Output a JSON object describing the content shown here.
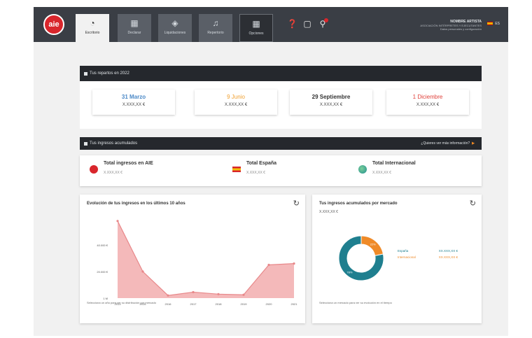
{
  "header": {
    "logo": "aie",
    "tabs": [
      {
        "label": "Escritorio",
        "icon": "dashboard-icon"
      },
      {
        "label": "Declarar",
        "icon": "calendar-icon"
      },
      {
        "label": "Liquidaciones",
        "icon": "coins-icon"
      },
      {
        "label": "Repertorio",
        "icon": "music-note-icon"
      },
      {
        "label": "Opciones",
        "icon": "grid-icon"
      }
    ],
    "user_name": "NOMBRE ARTISTA",
    "user_sub": "ASOCIACIÓN INTÉRPRETES Y EJECUTANTES",
    "user_link": "Datos personales y configuración",
    "lang": "ES"
  },
  "payments": {
    "title": "Tus repartos en 2022",
    "cards": [
      {
        "date": "31 Marzo",
        "value": "X.XXX,XX €",
        "color": "#4a88c7"
      },
      {
        "date": "9 Junio",
        "value": "X.XXX,XX €",
        "color": "#f0a030"
      },
      {
        "date": "29 Septiembre",
        "value": "X.XXX,XX €",
        "color": "#333333"
      },
      {
        "date": "1 Diciembre",
        "value": "X.XXX,XX €",
        "color": "#e0403a"
      }
    ]
  },
  "income": {
    "title": "Tus ingresos acumulados",
    "more": "¿Quieres ver más información?",
    "totals": [
      {
        "label": "Total ingresos en AIE",
        "value": "X.XXX,XX €",
        "icon": "aie-logo-icon"
      },
      {
        "label": "Total España",
        "value": "X.XXX,XX €",
        "icon": "spain-flag-icon"
      },
      {
        "label": "Total Internacional",
        "value": "X.XXX,XX €",
        "icon": "globe-icon"
      }
    ]
  },
  "evolution": {
    "title": "Evolución de tus ingresos en los últimos 10 años",
    "hint": "Selecciona un año para ver su distribución por mercado"
  },
  "market": {
    "title": "Tus ingresos acumulados por mercado",
    "value": "X.XXX,XX €",
    "hint": "Selecciona un mercado para ver su evolución en el tiempo"
  },
  "chart_data": [
    {
      "type": "area",
      "title": "Evolución de tus ingresos en los últimos 10 años",
      "x": [
        "2013",
        "2015",
        "2016",
        "2017",
        "2018",
        "2019",
        "2020",
        "2021"
      ],
      "y_ticks": [
        "1 M",
        "20.000 €",
        "40.000 €"
      ],
      "values": [
        58000,
        20000,
        2000,
        4500,
        3000,
        2500,
        25000,
        26000
      ],
      "ylim": [
        0,
        60000
      ],
      "color": "#e8888a"
    },
    {
      "type": "pie",
      "title": "Tus ingresos acumulados por mercado",
      "labels": [
        "España",
        "Internacional"
      ],
      "label_values": [
        "XX.XXX,XX €",
        "XX.XXX,XX €"
      ],
      "slice_labels": [
        "78%",
        "22%"
      ],
      "values": [
        78,
        22
      ],
      "colors": [
        "#1f7f8f",
        "#ef8a28"
      ]
    }
  ]
}
